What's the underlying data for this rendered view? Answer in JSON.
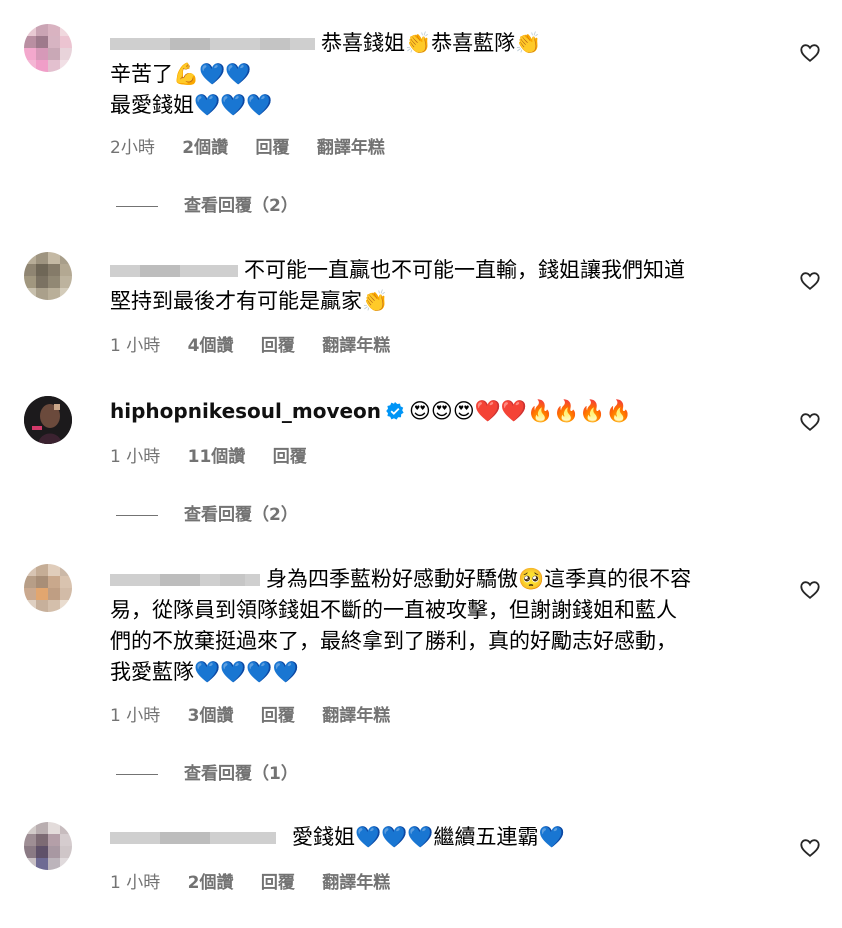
{
  "comments": [
    {
      "text": "恭喜錢姐👏恭喜藍隊👏\n辛苦了💪💙💙\n最愛錢姐💙💙💙",
      "time": "2小時",
      "likes": "2個讚",
      "reply": "回覆",
      "translate": "翻譯年糕",
      "view_replies": "查看回覆（2）",
      "avatar_colors": [
        "#e8c9d3",
        "#caa4b4",
        "#d9b3c1",
        "#f0d8de",
        "#b98fa2",
        "#9e7a8c",
        "#d7b4c2",
        "#ecc4d1",
        "#f3a8cd",
        "#d699b8",
        "#c9a8b6",
        "#e8d3da",
        "#f4b6d4",
        "#f09ec8",
        "#e3c0cf",
        "#f1dfe5"
      ]
    },
    {
      "text": "不可能一直贏也不可能一直輸，錢姐讓我們知道\n堅持到最後才有可能是贏家👏",
      "time": "1 小時",
      "likes": "4個讚",
      "reply": "回覆",
      "translate": "翻譯年糕",
      "avatar_colors": [
        "#b7ad98",
        "#9e9480",
        "#c4b9a4",
        "#a89e8a",
        "#8f8572",
        "#6f6757",
        "#857b69",
        "#b3a892",
        "#a1977f",
        "#7b7262",
        "#918874",
        "#bdb39e",
        "#c7bfac",
        "#aaa08b",
        "#b9af99",
        "#d3cbb9"
      ]
    },
    {
      "username": "hiphopnikesoul_moveon",
      "text": "😍😍😍❤️❤️🔥🔥🔥🔥",
      "time": "1 小時",
      "likes": "11個讚",
      "reply": "回覆",
      "view_replies": "查看回覆（2）"
    },
    {
      "text": "身為四季藍粉好感動好驕傲🥺這季真的很不容\n易，從隊員到領隊錢姐不斷的一直被攻擊，但謝謝錢姐和藍人\n們的不放棄挺過來了，最終拿到了勝利，真的好勵志好感動，\n我愛藍隊💙💙💙💙",
      "time": "1 小時",
      "likes": "3個讚",
      "reply": "回覆",
      "translate": "翻譯年糕",
      "view_replies": "查看回覆（1）",
      "avatar_colors": [
        "#d7c4b3",
        "#c5ad96",
        "#e0cdbb",
        "#cbb8a7",
        "#b79e87",
        "#a88e77",
        "#c9a88c",
        "#d9c3af",
        "#caa98f",
        "#e2a66f",
        "#bf9e83",
        "#d2bba7",
        "#dfd0c2",
        "#c7b09b",
        "#d4bfab",
        "#e9dccf"
      ]
    },
    {
      "text": "愛錢姐💙💙💙繼續五連霸💙",
      "time": "1 小時",
      "likes": "2個讚",
      "reply": "回覆",
      "translate": "翻譯年糕",
      "avatar_colors": [
        "#d2cbc9",
        "#b9aeb0",
        "#e3dcdb",
        "#c7bcbe",
        "#9e8e94",
        "#7d6b74",
        "#b49fa8",
        "#d5ccce",
        "#8a7a84",
        "#5f5169",
        "#a898a2",
        "#cfc6c8",
        "#c8c0c4",
        "#6e6a93",
        "#bcb4bb",
        "#e0dadc"
      ]
    }
  ]
}
